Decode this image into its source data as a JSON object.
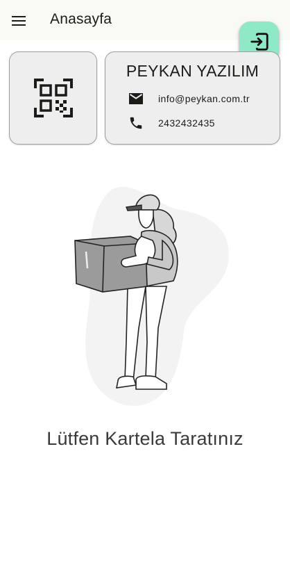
{
  "app_bar": {
    "title": "Anasayfa",
    "menu_icon": "hamburger-menu-icon"
  },
  "logout_button": {
    "icon": "logout-icon",
    "color": "#8fe8c6"
  },
  "qr_card": {
    "icon": "qr-code-scanner-icon"
  },
  "company_card": {
    "name": "PEYKAN YAZILIM",
    "email_icon": "email-icon",
    "email": "info@peykan.com.tr",
    "phone_icon": "phone-icon",
    "phone": "2432432435"
  },
  "illustration": {
    "subject": "delivery-person-holding-box"
  },
  "message": "Lütfen Kartela Taratınız"
}
